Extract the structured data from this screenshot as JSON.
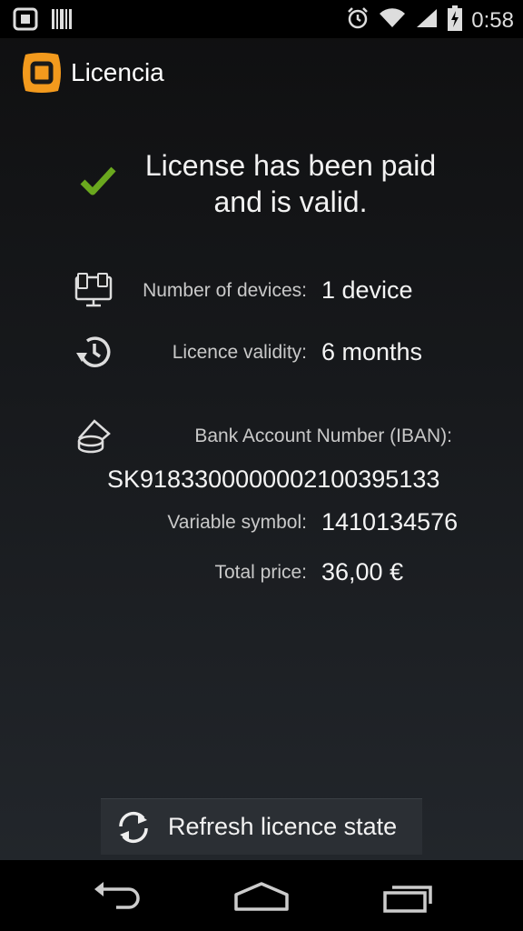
{
  "status_bar": {
    "time": "0:58",
    "left_icons": [
      "notification-app-icon",
      "barcode-icon"
    ],
    "right_icons": [
      "alarm-icon",
      "wifi-icon",
      "signal-icon",
      "battery-charging-icon"
    ]
  },
  "action_bar": {
    "title": "Licencia",
    "logo_color": "#f39a1d"
  },
  "license": {
    "status_message": "License has been paid and is valid.",
    "status_color": "#6aa81e",
    "devices_label": "Number of devices:",
    "devices_value": "1 device",
    "validity_label": "Licence validity:",
    "validity_value": "6 months",
    "iban_label": "Bank Account Number (IBAN):",
    "iban_value": "SK9183300000002100395133",
    "variable_symbol_label": "Variable symbol:",
    "variable_symbol_value": "1410134576",
    "total_price_label": "Total price:",
    "total_price_value": "36,00 €"
  },
  "actions": {
    "refresh_label": "Refresh licence state"
  },
  "nav_bar": {
    "buttons": [
      "back-icon",
      "home-icon",
      "recent-apps-icon"
    ]
  }
}
